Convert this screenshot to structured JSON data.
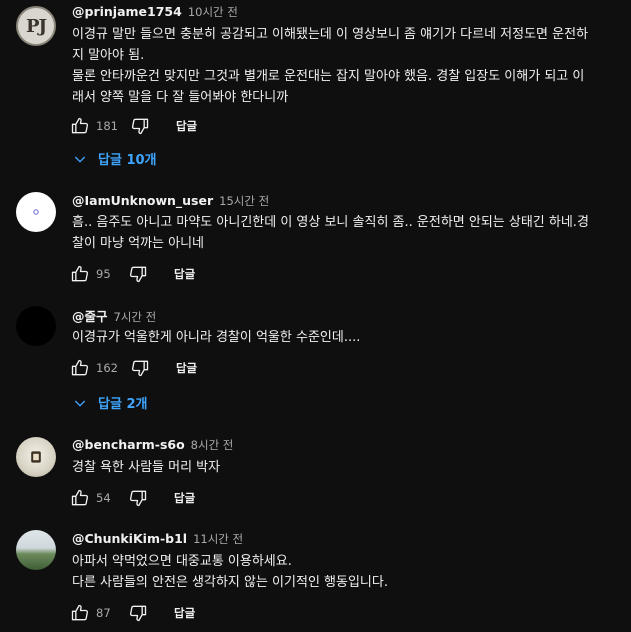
{
  "comments": [
    {
      "avatar_text": "PJ",
      "handle": "@prinjame1754",
      "time": "10시간 전",
      "text": "이경규 말만 들으면 충분히 공감되고 이해됐는데 이 영상보니 좀 얘기가 다르네 저정도면 운전하\n지 말아야 됨.\n물론 안타까운건 맞지만 그것과 별개로 운전대는 잡지 말아야 했음. 경찰 입장도 이해가 되고 이\n래서 양쪽 말을 다 잘 들어봐야 한다니까",
      "likes": "181",
      "reply_label": "답글",
      "replies_label": "답글 10개"
    },
    {
      "handle": "@IamUnknown_user",
      "time": "15시간 전",
      "text": "흠.. 음주도 아니고 마약도 아니긴한데 이 영상 보니 솔직히 좀.. 운전하면 안되는 상태긴 하네.경\n찰이 마냥 억까는 아니네",
      "likes": "95",
      "reply_label": "답글"
    },
    {
      "handle": "@줄구",
      "time": "7시간 전",
      "text": "이경규가 억울한게 아니라 경찰이 억울한 수준인데....",
      "likes": "162",
      "reply_label": "답글",
      "replies_label": "답글 2개"
    },
    {
      "handle": "@bencharm-s6o",
      "time": "8시간 전",
      "text": "경찰 욕한 사람들 머리 박자",
      "likes": "54",
      "reply_label": "답글"
    },
    {
      "handle": "@ChunkiKim-b1l",
      "time": "11시간 전",
      "text": "아파서 약먹었으면 대중교통 이용하세요.\n다른 사람들의 안전은 생각하지 않는 이기적인 행동입니다.",
      "likes": "87",
      "reply_label": "답글"
    }
  ],
  "icons": {
    "like": "thumb-up-icon",
    "dislike": "thumb-down-icon",
    "expand": "chevron-down-icon"
  },
  "colors": {
    "background": "#0f0f0f",
    "text": "#f1f1f1",
    "secondary_text": "#aaaaaa",
    "link": "#3ea6ff"
  }
}
